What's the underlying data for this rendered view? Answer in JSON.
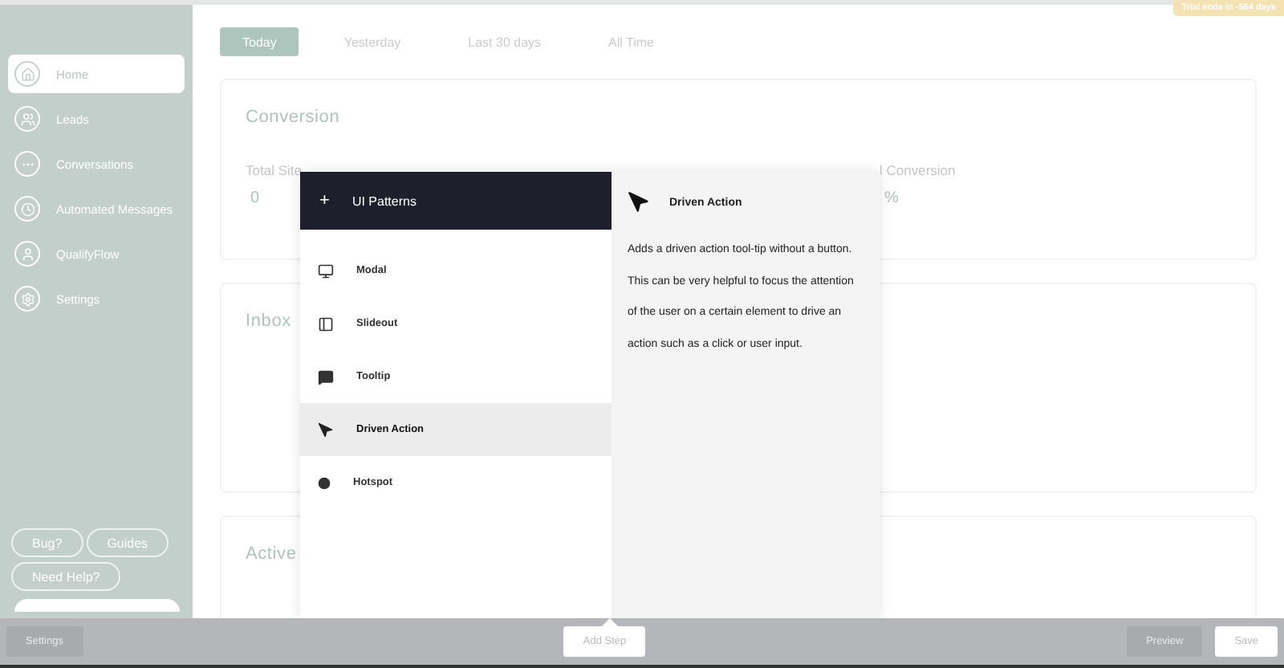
{
  "trial_badge": "Trial ends in -564 days",
  "sidebar": {
    "items": [
      {
        "label": "Home",
        "selected": true
      },
      {
        "label": "Leads",
        "selected": false
      },
      {
        "label": "Conversations",
        "selected": false
      },
      {
        "label": "Automated Messages",
        "selected": false
      },
      {
        "label": "QualifyFlow",
        "selected": false
      },
      {
        "label": "Settings",
        "selected": false
      }
    ],
    "help_buttons": [
      "Bug?",
      "Guides",
      "Need Help?"
    ]
  },
  "tabs": [
    {
      "label": "Today",
      "selected": true
    },
    {
      "label": "Yesterday",
      "selected": false
    },
    {
      "label": "Last 30 days",
      "selected": false
    },
    {
      "label": "All Time",
      "selected": false
    }
  ],
  "cards": [
    {
      "title": "Conversion",
      "stats": [
        {
          "label": "Total Site",
          "value": "0"
        },
        {
          "label": "l Conversion",
          "value": "%"
        }
      ]
    },
    {
      "title": "Inbox"
    },
    {
      "title": "Active"
    }
  ],
  "popup": {
    "header": {
      "icon": "+",
      "title": "UI Patterns"
    },
    "items": [
      {
        "label": "Modal",
        "selected": false
      },
      {
        "label": "Slideout",
        "selected": false
      },
      {
        "label": "Tooltip",
        "selected": false
      },
      {
        "label": "Driven Action",
        "selected": true
      },
      {
        "label": "Hotspot",
        "selected": false
      }
    ],
    "detail": {
      "title": "Driven Action",
      "description": "Adds a driven action tool-tip without a button. This can be very helpful to focus the attention of the user on a certain element to drive an action such as a click or user input."
    }
  },
  "bottom_bar": {
    "settings": "Settings",
    "add_step": "Add Step",
    "preview": "Preview",
    "save": "Save"
  }
}
